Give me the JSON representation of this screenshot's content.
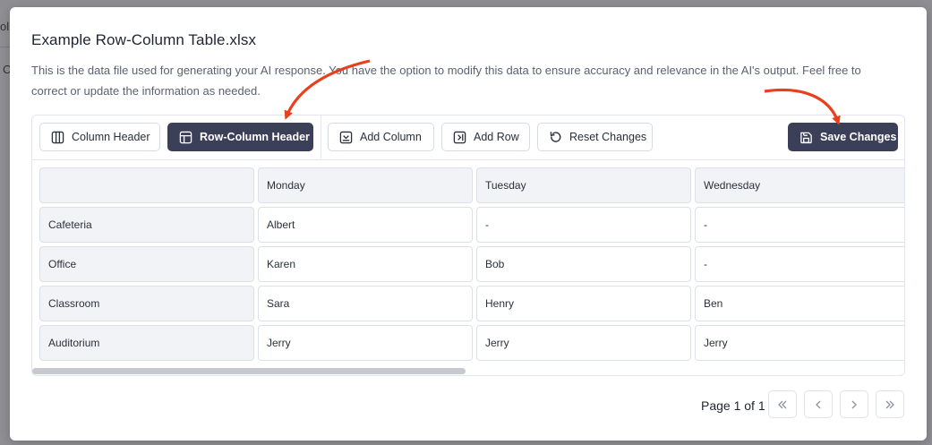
{
  "background": {
    "fragments": [
      "olu",
      "C"
    ]
  },
  "modal": {
    "title": "Example Row-Column Table.xlsx",
    "description": "This is the data file used for generating your AI response. You have the option to modify this data to ensure accuracy and relevance in the AI's output. Feel free to correct or update the information as needed."
  },
  "toolbar": {
    "column_header": "Column Header",
    "row_column_header": "Row-Column Header",
    "add_column": "Add Column",
    "add_row": "Add Row",
    "reset_changes": "Reset Changes",
    "save_changes": "Save Changes"
  },
  "table": {
    "columns": [
      "",
      "Monday",
      "Tuesday",
      "Wednesday"
    ],
    "rows": [
      [
        "Cafeteria",
        "Albert",
        "-",
        "-"
      ],
      [
        "Office",
        "Karen",
        "Bob",
        "-"
      ],
      [
        "Classroom",
        "Sara",
        "Henry",
        "Ben"
      ],
      [
        "Auditorium",
        "Jerry",
        "Jerry",
        "Jerry"
      ]
    ]
  },
  "pagination": {
    "label": "Page 1 of 1"
  },
  "colors": {
    "primary_dark": "#3c3f58",
    "annotation_arrow": "#e8401c"
  },
  "icons": [
    "table-columns-icon",
    "table-layout-icon",
    "add-column-icon",
    "add-row-icon",
    "reset-icon",
    "save-icon",
    "first-page-icon",
    "prev-page-icon",
    "next-page-icon",
    "last-page-icon"
  ]
}
